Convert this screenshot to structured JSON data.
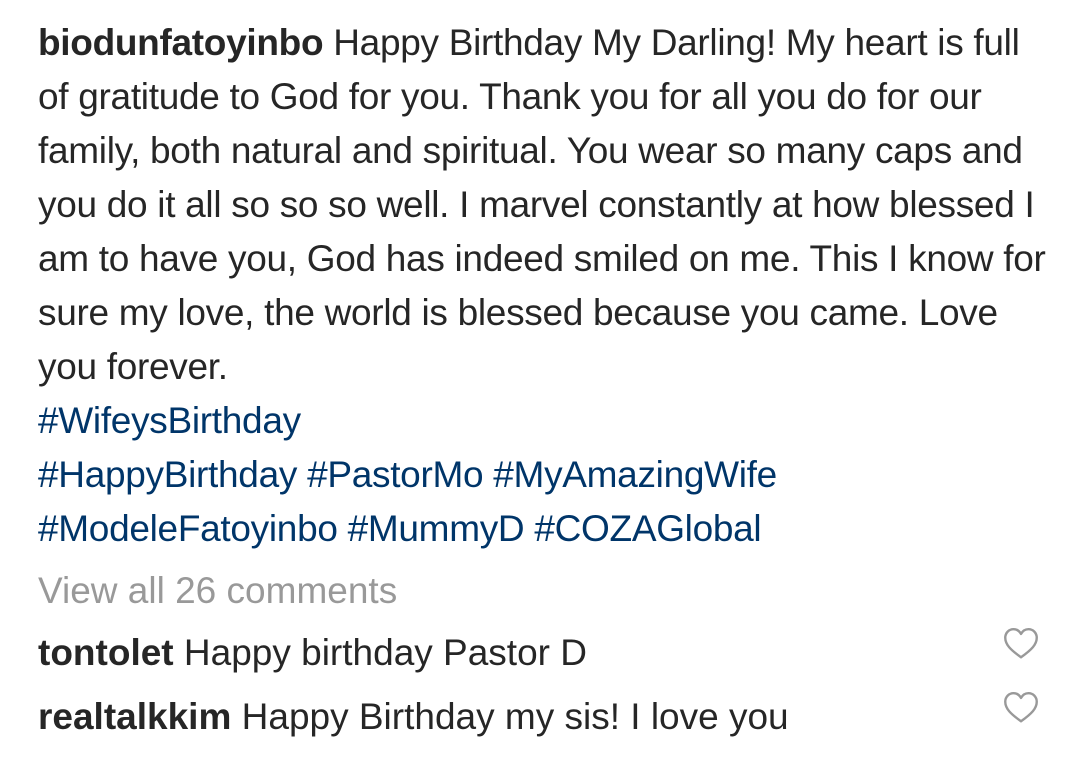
{
  "post": {
    "username": "biodunfatoyinbo",
    "caption_text": "Happy Birthday My Darling! My heart is full of gratitude to God for you. Thank you for all you do for our family, both natural and spiritual. You wear so many caps and you do it all so so so well. I marvel constantly at how blessed I am to have you, God has indeed smiled on me. This I know for sure my love, the world is blessed because you came. Love you forever.",
    "hashtags": [
      "#WifeysBirthday",
      "#HappyBirthday",
      "#PastorMo",
      "#MyAmazingWife",
      "#ModeleFatoyinbo",
      "#MummyD",
      "#COZAGlobal"
    ]
  },
  "view_all_comments": "View all 26 comments",
  "comments": [
    {
      "username": "tontolet",
      "text": "Happy birthday Pastor D",
      "like_icon": "heart-outline-icon"
    },
    {
      "username": "realtalkkim",
      "text": "Happy Birthday my sis! I love you",
      "like_icon": "heart-outline-icon"
    }
  ],
  "colors": {
    "text": "#262626",
    "hashtag": "#003569",
    "muted": "#999999",
    "icon": "#999999"
  }
}
